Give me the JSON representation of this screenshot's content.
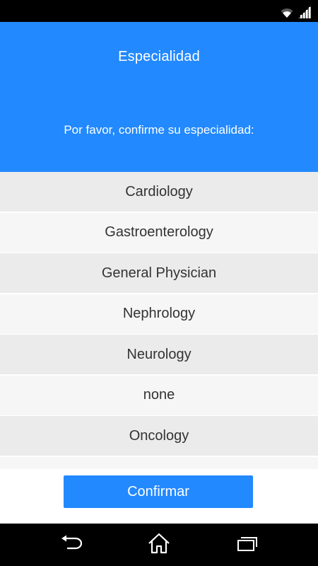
{
  "status_bar": {
    "icons": [
      "wifi-icon",
      "signal-icon"
    ]
  },
  "header": {
    "title": "Especialidad",
    "subtitle": "Por favor, confirme su especialidad:"
  },
  "specialties": [
    "Cardiology",
    "Gastroenterology",
    "General Physician",
    "Nephrology",
    "Neurology",
    "none",
    "Oncology"
  ],
  "actions": {
    "confirm_label": "Confirmar"
  },
  "nav_bar": {
    "buttons": [
      "back-icon",
      "home-icon",
      "recents-icon"
    ]
  },
  "colors": {
    "accent": "#2289ff",
    "row_odd": "#ebebeb",
    "row_even": "#f6f6f6",
    "text": "#333333"
  }
}
